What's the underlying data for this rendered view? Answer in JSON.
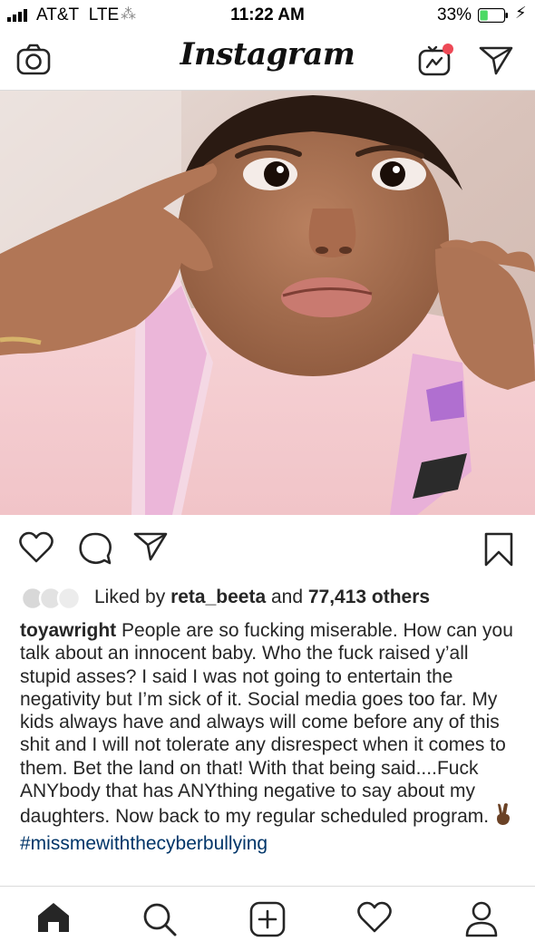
{
  "status_bar": {
    "carrier": "AT&T",
    "network": "LTE",
    "time": "11:22 AM",
    "battery_percent": "33%",
    "battery_level": 0.33,
    "battery_color": "#4cd964"
  },
  "header": {
    "logo": "Instagram",
    "left_icon": "camera-icon",
    "right_icons": [
      "igtv-icon",
      "direct-message-icon"
    ],
    "notification_dot_color": "#ed4956"
  },
  "post": {
    "image_alt": "photo",
    "actions": [
      "heart-icon",
      "comment-icon",
      "share-icon",
      "bookmark-icon"
    ],
    "likes": {
      "prefix": "Liked by ",
      "user": "reta_beeta",
      "middle": " and ",
      "count": "77,413 others"
    },
    "caption": {
      "username": "toyawright",
      "text": " People are so fucking miserable. How can you talk about an innocent baby. Who the fuck raised y’all stupid asses? I said I was not going to entertain the negativity but I’m sick of it. Social media goes too far. My kids always have and always will come before any of this shit and I will not tolerate any disrespect when it comes to them. Bet the land on that! With that being said....Fuck ANYbody that has ANYthing negative to say about my daughters. Now back to my regular scheduled program. ",
      "emoji": "victory-hand-emoji",
      "hashtag": "#missmewiththecyberbullying"
    }
  },
  "tab_bar": {
    "items": [
      "home-icon",
      "search-icon",
      "new-post-icon",
      "activity-icon",
      "profile-icon"
    ]
  }
}
